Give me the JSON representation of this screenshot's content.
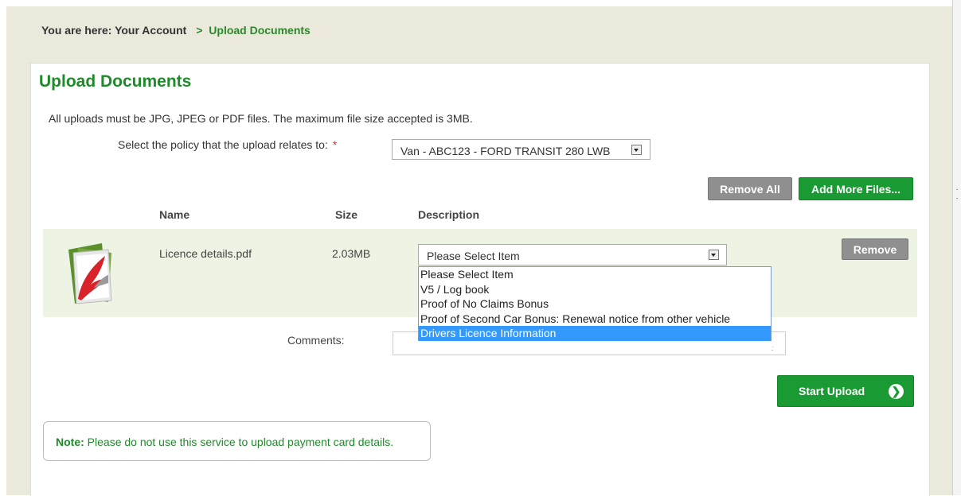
{
  "breadcrumb": {
    "prefix": "You are here:",
    "parent": "Your Account",
    "separator": ">",
    "current": "Upload Documents"
  },
  "page": {
    "title": "Upload Documents",
    "info": "All uploads must be JPG, JPEG or PDF files. The maximum file size accepted is 3MB."
  },
  "policy": {
    "label": "Select the policy that the upload relates to:",
    "required_mark": "*",
    "selected": "Van - ABC123 - FORD TRANSIT 280 LWB"
  },
  "toolbar": {
    "remove_all": "Remove All",
    "add_more": "Add More Files..."
  },
  "columns": {
    "name": "Name",
    "size": "Size",
    "description": "Description"
  },
  "file": {
    "name": "Licence details.pdf",
    "size": "2.03MB",
    "description_selected": "Please Select Item",
    "remove": "Remove",
    "icon": "pdf-file-icon"
  },
  "description_options": [
    "Please Select Item",
    "V5 / Log book",
    "Proof of No Claims Bonus",
    "Proof of Second Car Bonus: Renewal notice from other vehicle",
    "Drivers Licence Information"
  ],
  "description_highlighted_index": 4,
  "comments": {
    "label": "Comments:",
    "value": ""
  },
  "start_upload": "Start Upload",
  "note": {
    "label": "Note:",
    "text": "Please do not use this service to upload payment card details."
  },
  "colors": {
    "brand_green": "#1a9a32",
    "title_green": "#1f8a2a",
    "grey_button": "#8f8f8f",
    "row_highlight": "#eef4e4",
    "option_highlight": "#3399ff"
  }
}
